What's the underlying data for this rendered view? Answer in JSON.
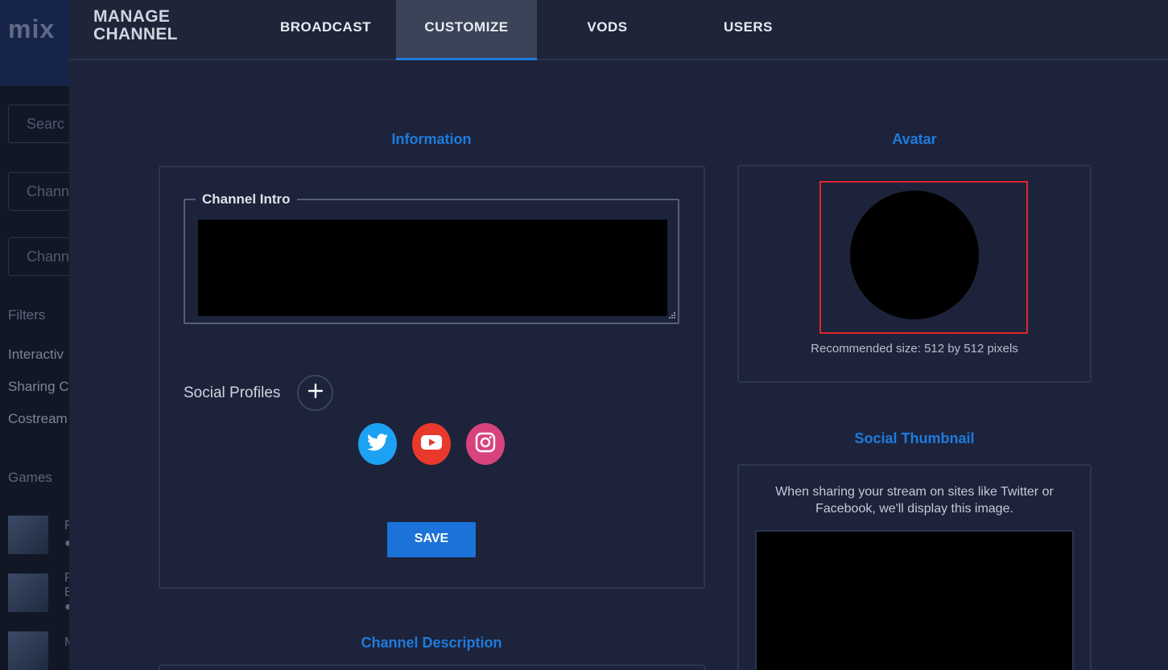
{
  "background": {
    "logo": "mix",
    "inputs": [
      "Searc",
      "Chann",
      "Chann"
    ],
    "filters_label": "Filters",
    "filters": [
      "Interactiv",
      "Sharing C",
      "Costream"
    ],
    "games_label": "Games",
    "games": [
      {
        "lines": [
          "F",
          "●"
        ]
      },
      {
        "lines": [
          "P",
          "E",
          "●"
        ]
      },
      {
        "lines": [
          "M"
        ]
      }
    ]
  },
  "header": {
    "title_line1": "MANAGE",
    "title_line2": "CHANNEL",
    "tabs": [
      {
        "label": "BROADCAST",
        "active": false
      },
      {
        "label": "CUSTOMIZE",
        "active": true
      },
      {
        "label": "VODS",
        "active": false
      },
      {
        "label": "USERS",
        "active": false
      }
    ]
  },
  "information": {
    "heading": "Information",
    "channel_intro_label": "Channel Intro",
    "social_profiles_label": "Social Profiles",
    "social_icons": [
      "twitter-icon",
      "youtube-icon",
      "instagram-icon"
    ],
    "save_label": "SAVE"
  },
  "avatar": {
    "heading": "Avatar",
    "hint": "Recommended size: 512 by 512 pixels"
  },
  "social_thumbnail": {
    "heading": "Social Thumbnail",
    "description": "When sharing your stream on sites like Twitter or Facebook, we'll display this image."
  },
  "channel_description": {
    "heading": "Channel Description"
  },
  "colors": {
    "accent": "#1f7bdd",
    "twitter": "#1da1f2",
    "youtube": "#e8392c",
    "instagram": "#d8437e",
    "highlight": "#e0262f"
  }
}
